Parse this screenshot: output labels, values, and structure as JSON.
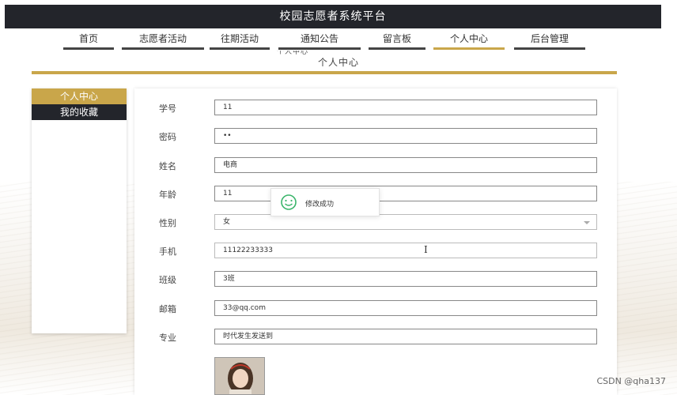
{
  "app": {
    "title": "校园志愿者系统平台"
  },
  "nav": {
    "items": [
      {
        "label": "首页",
        "active": false
      },
      {
        "label": "志愿者活动",
        "active": false
      },
      {
        "label": "往期活动",
        "active": false
      },
      {
        "label": "通知公告",
        "active": false
      },
      {
        "label": "留言板",
        "active": false
      },
      {
        "label": "个人中心",
        "active": true
      },
      {
        "label": "后台管理",
        "active": false
      }
    ]
  },
  "section": {
    "title": "个人中心"
  },
  "sidebar": {
    "items": [
      {
        "label": "个人中心",
        "active": true
      },
      {
        "label": "我的收藏",
        "active": false
      }
    ]
  },
  "form": {
    "fields": [
      {
        "label": "学号",
        "value": "11"
      },
      {
        "label": "密码",
        "value": "••"
      },
      {
        "label": "姓名",
        "value": "电商"
      },
      {
        "label": "年龄",
        "value": "11"
      },
      {
        "label": "性别",
        "value": "女"
      },
      {
        "label": "手机",
        "value": "11122233333"
      },
      {
        "label": "班级",
        "value": "3班"
      },
      {
        "label": "邮箱",
        "value": "33@qq.com"
      },
      {
        "label": "专业",
        "value": "时代发生发送到"
      }
    ]
  },
  "toast": {
    "message": "修改成功",
    "icon": "smile-icon",
    "color": "#3bb56b"
  },
  "watermark": {
    "text": "CSDN @qha137"
  },
  "colors": {
    "accent": "#c9a64a",
    "dark": "#23252b"
  }
}
